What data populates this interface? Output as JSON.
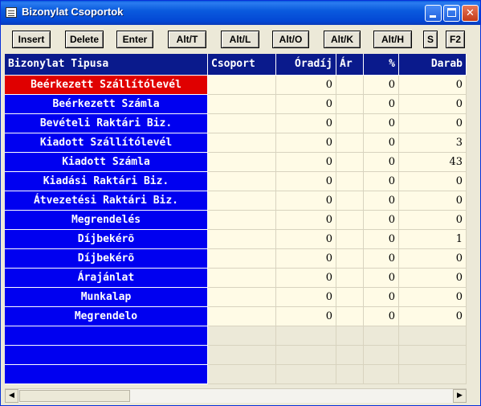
{
  "window": {
    "title": "Bizonylat Csoportok"
  },
  "titlebar_buttons": {
    "minimize": "",
    "maximize": "",
    "close": "✕"
  },
  "toolbar": {
    "buttons": [
      "Insert",
      "Delete",
      "Enter",
      "Alt/T",
      "Alt/L",
      "Alt/O",
      "Alt/K",
      "Alt/H",
      "S",
      "F2"
    ]
  },
  "table": {
    "columns": [
      "Bizonylat Tipusa",
      "Csoport",
      "Óradíj",
      "Ár",
      "%",
      "Darab"
    ],
    "rows": [
      {
        "name": "Beérkezett Szállítólevél",
        "csoport": "",
        "oradij": "0",
        "ar": "",
        "pct": "0",
        "darab": "0",
        "selected": true
      },
      {
        "name": "Beérkezett Számla",
        "csoport": "",
        "oradij": "0",
        "ar": "",
        "pct": "0",
        "darab": "0"
      },
      {
        "name": "Bevételi Raktári Biz.",
        "csoport": "",
        "oradij": "0",
        "ar": "",
        "pct": "0",
        "darab": "0"
      },
      {
        "name": "Kiadott Szállítólevél",
        "csoport": "",
        "oradij": "0",
        "ar": "",
        "pct": "0",
        "darab": "3"
      },
      {
        "name": "Kiadott Számla",
        "csoport": "",
        "oradij": "0",
        "ar": "",
        "pct": "0",
        "darab": "43"
      },
      {
        "name": "Kiadási Raktári Biz.",
        "csoport": "",
        "oradij": "0",
        "ar": "",
        "pct": "0",
        "darab": "0"
      },
      {
        "name": "Átvezetési Raktári Biz.",
        "csoport": "",
        "oradij": "0",
        "ar": "",
        "pct": "0",
        "darab": "0"
      },
      {
        "name": "Megrendelés",
        "csoport": "",
        "oradij": "0",
        "ar": "",
        "pct": "0",
        "darab": "0"
      },
      {
        "name": "Díjbekérõ",
        "csoport": "",
        "oradij": "0",
        "ar": "",
        "pct": "0",
        "darab": "1"
      },
      {
        "name": "Díjbekérõ",
        "csoport": "",
        "oradij": "0",
        "ar": "",
        "pct": "0",
        "darab": "0"
      },
      {
        "name": "Árajánlat",
        "csoport": "",
        "oradij": "0",
        "ar": "",
        "pct": "0",
        "darab": "0"
      },
      {
        "name": "Munkalap",
        "csoport": "",
        "oradij": "0",
        "ar": "",
        "pct": "0",
        "darab": "0"
      },
      {
        "name": "Megrendelo",
        "csoport": "",
        "oradij": "0",
        "ar": "",
        "pct": "0",
        "darab": "0"
      }
    ],
    "empty_rows": 3
  },
  "scrollbar": {
    "left_arrow": "◀",
    "right_arrow": "▶"
  },
  "colors": {
    "title_bar": "#0a5bde",
    "header_bg": "#0a1a8c",
    "name_cell_bg": "#0000f0",
    "selected_row_bg": "#e00000",
    "value_cell_bg": "#fffbe6"
  }
}
